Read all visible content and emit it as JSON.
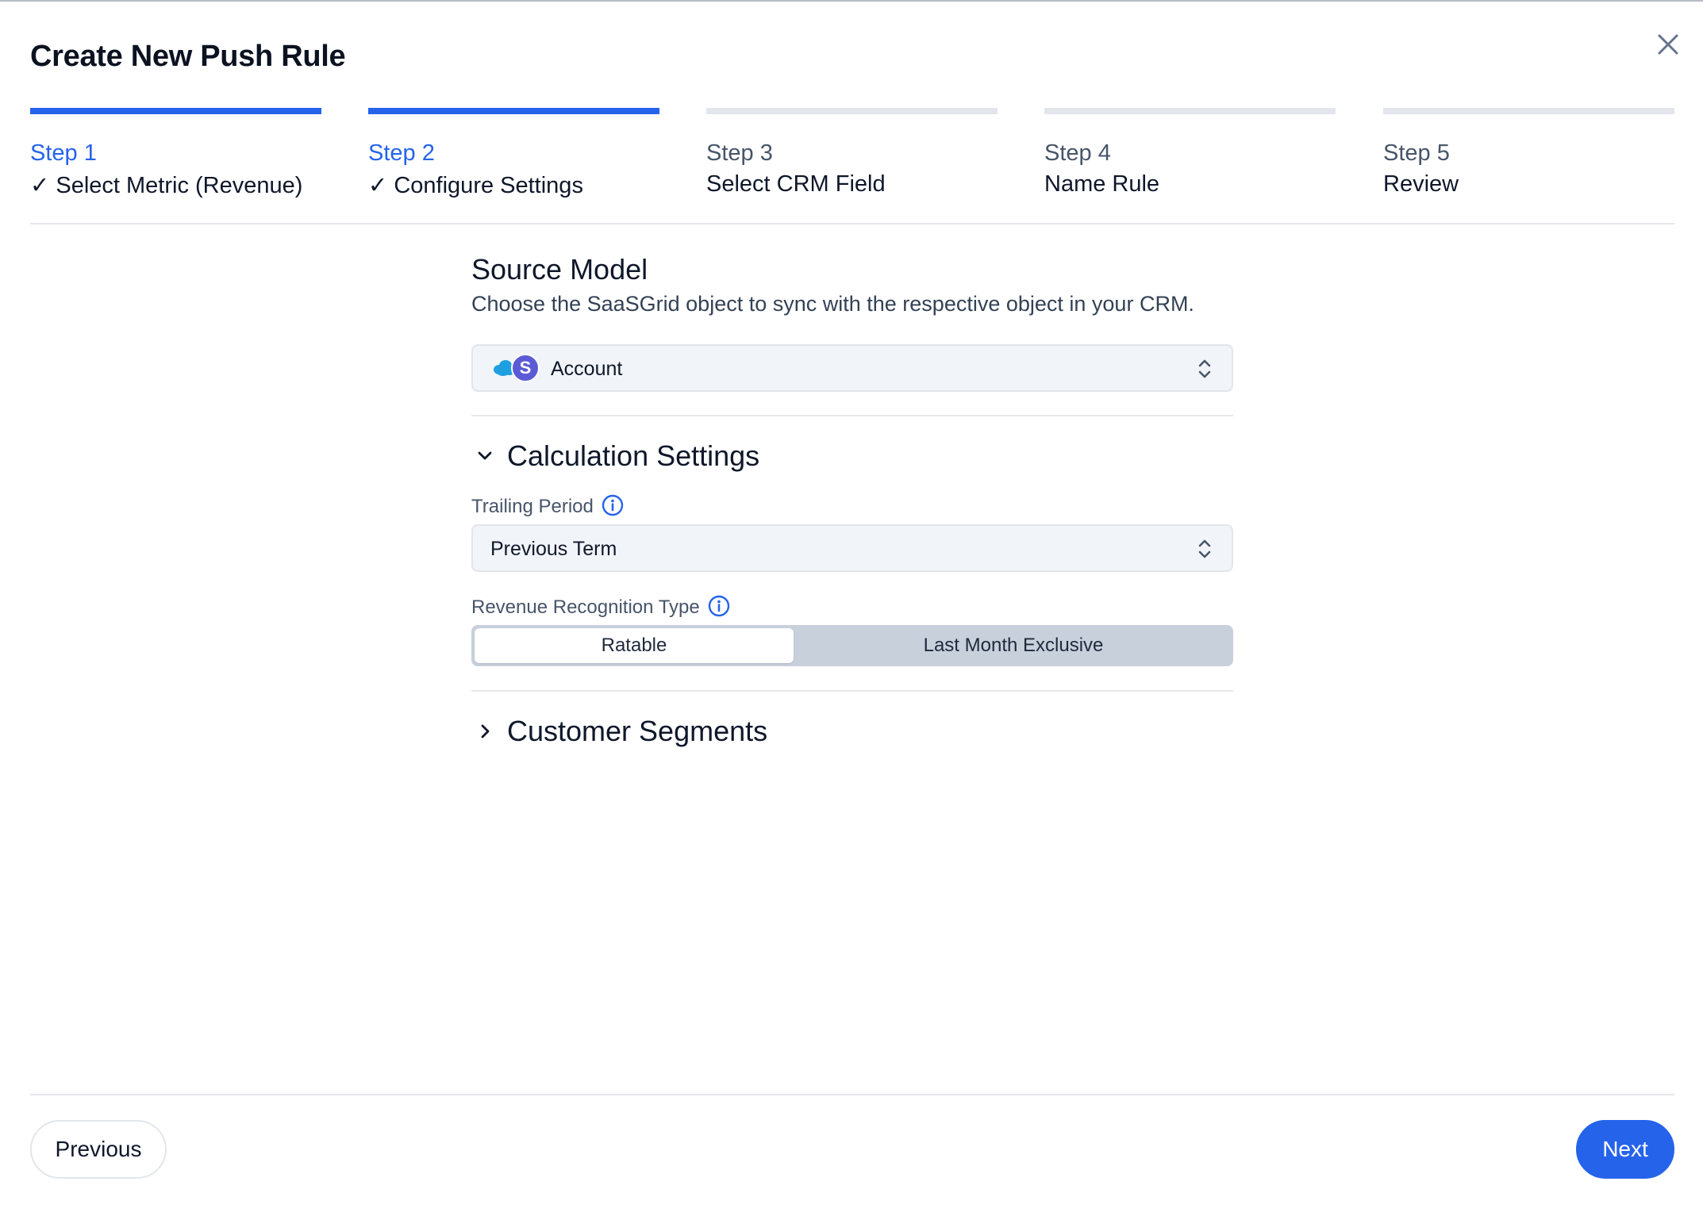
{
  "dialog": {
    "title": "Create New Push Rule"
  },
  "steps": [
    {
      "number": "Step 1",
      "label": "✓ Select Metric (Revenue)",
      "state": "complete"
    },
    {
      "number": "Step 2",
      "label": "✓ Configure Settings",
      "state": "complete"
    },
    {
      "number": "Step 3",
      "label": "Select CRM Field",
      "state": "pending"
    },
    {
      "number": "Step 4",
      "label": "Name Rule",
      "state": "pending"
    },
    {
      "number": "Step 5",
      "label": "Review",
      "state": "pending"
    }
  ],
  "source_model": {
    "title": "Source Model",
    "description": "Choose the SaaSGrid object to sync with the respective object in your CRM.",
    "selected": "Account",
    "logo_letter": "S",
    "icons": [
      "salesforce-cloud-icon",
      "saasgrid-logo-icon",
      "chevron-up-down-icon"
    ]
  },
  "calculation_settings": {
    "title": "Calculation Settings",
    "expanded": true,
    "trailing_period": {
      "label": "Trailing Period",
      "selected": "Previous Term"
    },
    "revenue_recognition": {
      "label": "Revenue Recognition Type",
      "options": [
        "Ratable",
        "Last Month Exclusive"
      ],
      "selected": "Ratable"
    }
  },
  "customer_segments": {
    "title": "Customer Segments",
    "expanded": false
  },
  "footer": {
    "previous_label": "Previous",
    "next_label": "Next"
  },
  "colors": {
    "accent": "#2563eb",
    "step_inactive": "#e2e6ec",
    "field_bg": "#f1f4f8",
    "segment_bg": "#c8d0dc"
  }
}
